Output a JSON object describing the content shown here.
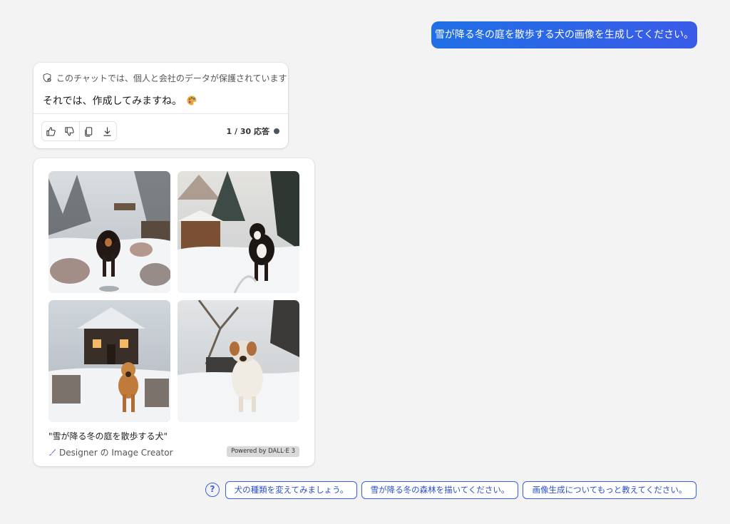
{
  "user_message": "雪が降る冬の庭を散歩する犬の画像を生成してください。",
  "answer": {
    "privacy_notice": "このチャットでは、個人と会社のデータが保護されています",
    "text": "それでは、作成してみますね。",
    "text_icon": "palette-icon",
    "actions": [
      "like-icon",
      "dislike-icon",
      "copy-icon",
      "download-icon"
    ],
    "response_count": "1 / 30 応答"
  },
  "image_result": {
    "images": [
      {
        "label": "dog-in-snowy-garden-1"
      },
      {
        "label": "dog-in-snowy-garden-2"
      },
      {
        "label": "dog-in-snowy-garden-3"
      },
      {
        "label": "dog-in-snowy-garden-4"
      }
    ],
    "caption": "\"雪が降る冬の庭を散歩する犬\"",
    "designer_label": "Designer の Image Creator",
    "powered_by": "Powered by DALL·E 3"
  },
  "suggestions": [
    "犬の種類を変えてみましょう。",
    "雪が降る冬の森林を描いてください。",
    "画像生成についてもっと教えてください。"
  ],
  "colors": {
    "accent": "#3b5fd9",
    "user_bubble": "#2f62e6",
    "background": "#f3f3f3"
  }
}
